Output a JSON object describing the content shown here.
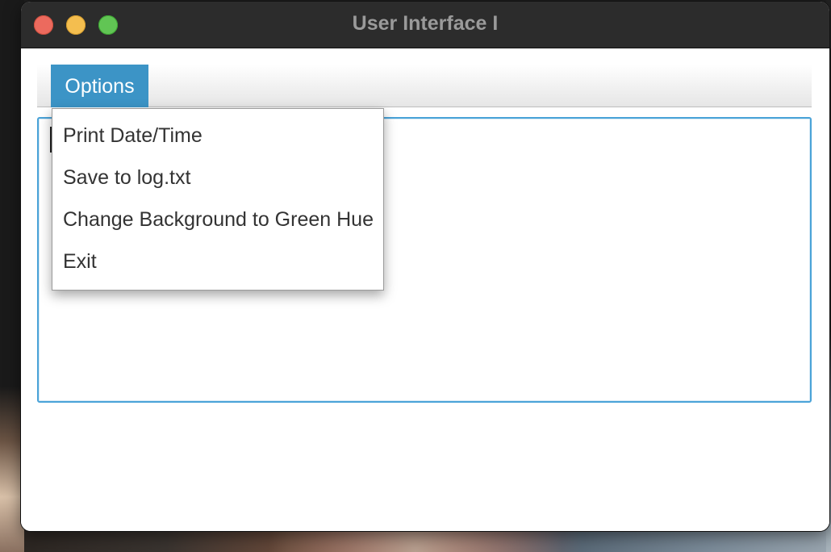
{
  "window": {
    "title": "User Interface I"
  },
  "menubar": {
    "menus": [
      {
        "label": "Options",
        "open": true
      }
    ]
  },
  "dropdown": {
    "items": [
      {
        "label": "Print Date/Time"
      },
      {
        "label": "Save to log.txt"
      },
      {
        "label": "Change Background to Green Hue"
      },
      {
        "label": "Exit"
      }
    ]
  },
  "colors": {
    "accent": "#3c94c6",
    "titlebar": "#2c2c2c",
    "close": "#ec6a5e",
    "minimize": "#f4be4f",
    "maximize": "#61c554",
    "focus_border": "#4aa3d8"
  },
  "icons": [
    "close-icon",
    "minimize-icon",
    "maximize-icon"
  ]
}
